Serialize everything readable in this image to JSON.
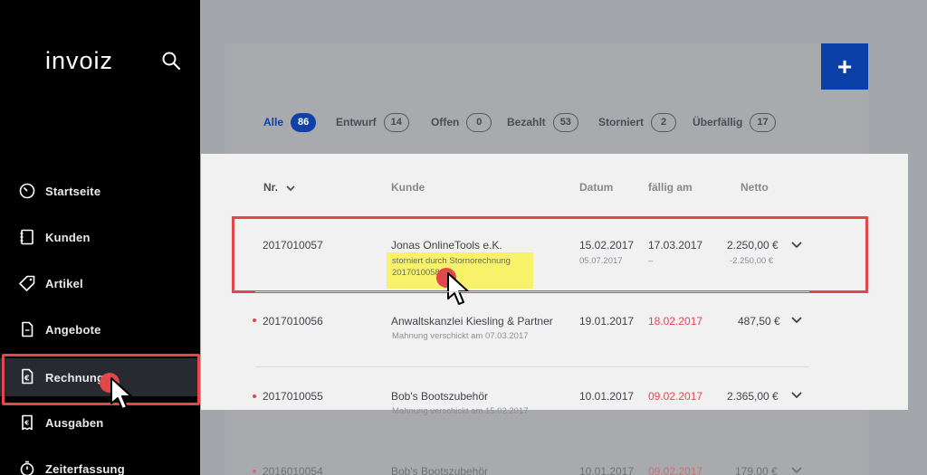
{
  "app": {
    "logo": "invoiz"
  },
  "sidebar": {
    "items": [
      {
        "label": "Startseite",
        "icon": "speedometer-icon"
      },
      {
        "label": "Kunden",
        "icon": "address-book-icon"
      },
      {
        "label": "Artikel",
        "icon": "price-tag-icon"
      },
      {
        "label": "Angebote",
        "icon": "document-icon"
      },
      {
        "label": "Rechnungen",
        "icon": "euro-document-icon",
        "active": true
      },
      {
        "label": "Ausgaben",
        "icon": "receipt-icon"
      },
      {
        "label": "Zeiterfassung",
        "icon": "stopwatch-icon"
      }
    ]
  },
  "toolbar": {
    "add_label": "+"
  },
  "filters": [
    {
      "label": "Alle",
      "count": "86",
      "active": true
    },
    {
      "label": "Entwurf",
      "count": "14"
    },
    {
      "label": "Offen",
      "count": "0"
    },
    {
      "label": "Bezahlt",
      "count": "53"
    },
    {
      "label": "Storniert",
      "count": "2"
    },
    {
      "label": "Überfällig",
      "count": "17"
    }
  ],
  "table": {
    "headers": {
      "nr": "Nr.",
      "kunde": "Kunde",
      "datum": "Datum",
      "faellig": "fällig am",
      "netto": "Netto"
    },
    "rows": [
      {
        "nr": "2017010057",
        "kunde": "Jonas OnlineTools e.K.",
        "note": "storniert durch Stornorechnung",
        "note2": "2017010058",
        "datum": "15.02.2017",
        "datum2": "05.07.2017",
        "faellig": "17.03.2017",
        "faellig2": "–",
        "netto": "2.250,00 €",
        "netto2": "-2.250,00 €"
      },
      {
        "nr": "2017010056",
        "kunde": "Anwaltskanzlei Kiesling & Partner",
        "note": "Mahnung verschickt am 07.03.2017",
        "datum": "19.01.2017",
        "faellig": "18.02.2017",
        "netto": "487,50 €",
        "overdue": true
      },
      {
        "nr": "2017010055",
        "kunde": "Bob's Bootszubehör",
        "note": "Mahnung verschickt am 15.02.2017",
        "datum": "10.01.2017",
        "faellig": "09.02.2017",
        "netto": "2.365,00 €",
        "overdue": true
      },
      {
        "nr": "2016010054",
        "kunde": "Bob's Bootszubehör",
        "datum": "10.01.2017",
        "faellig": "09.02.2017",
        "netto": "179,00 €",
        "overdue": true
      }
    ]
  },
  "colors": {
    "accent": "#1040a8",
    "danger": "#e2474b",
    "highlight": "#f7f26a",
    "sidebar": "#000000"
  }
}
